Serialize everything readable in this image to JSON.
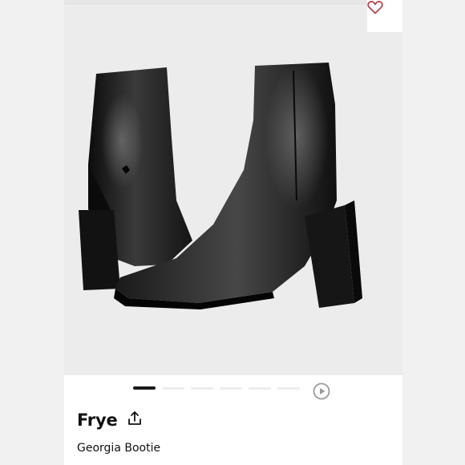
{
  "product": {
    "brand": "Frye",
    "name": "Georgia Bootie",
    "image_subject": "Pair of black leather ankle boots with block heels"
  },
  "gallery": {
    "slide_count": 6,
    "active_index": 0,
    "has_video": true
  },
  "icons": {
    "favorite": "heart-outline-icon",
    "share": "share-upload-icon",
    "play": "play-circle-icon"
  },
  "colors": {
    "heart": "#b4474f",
    "text": "#111111",
    "boot": "#151515",
    "photo_bg": "#ececec"
  }
}
